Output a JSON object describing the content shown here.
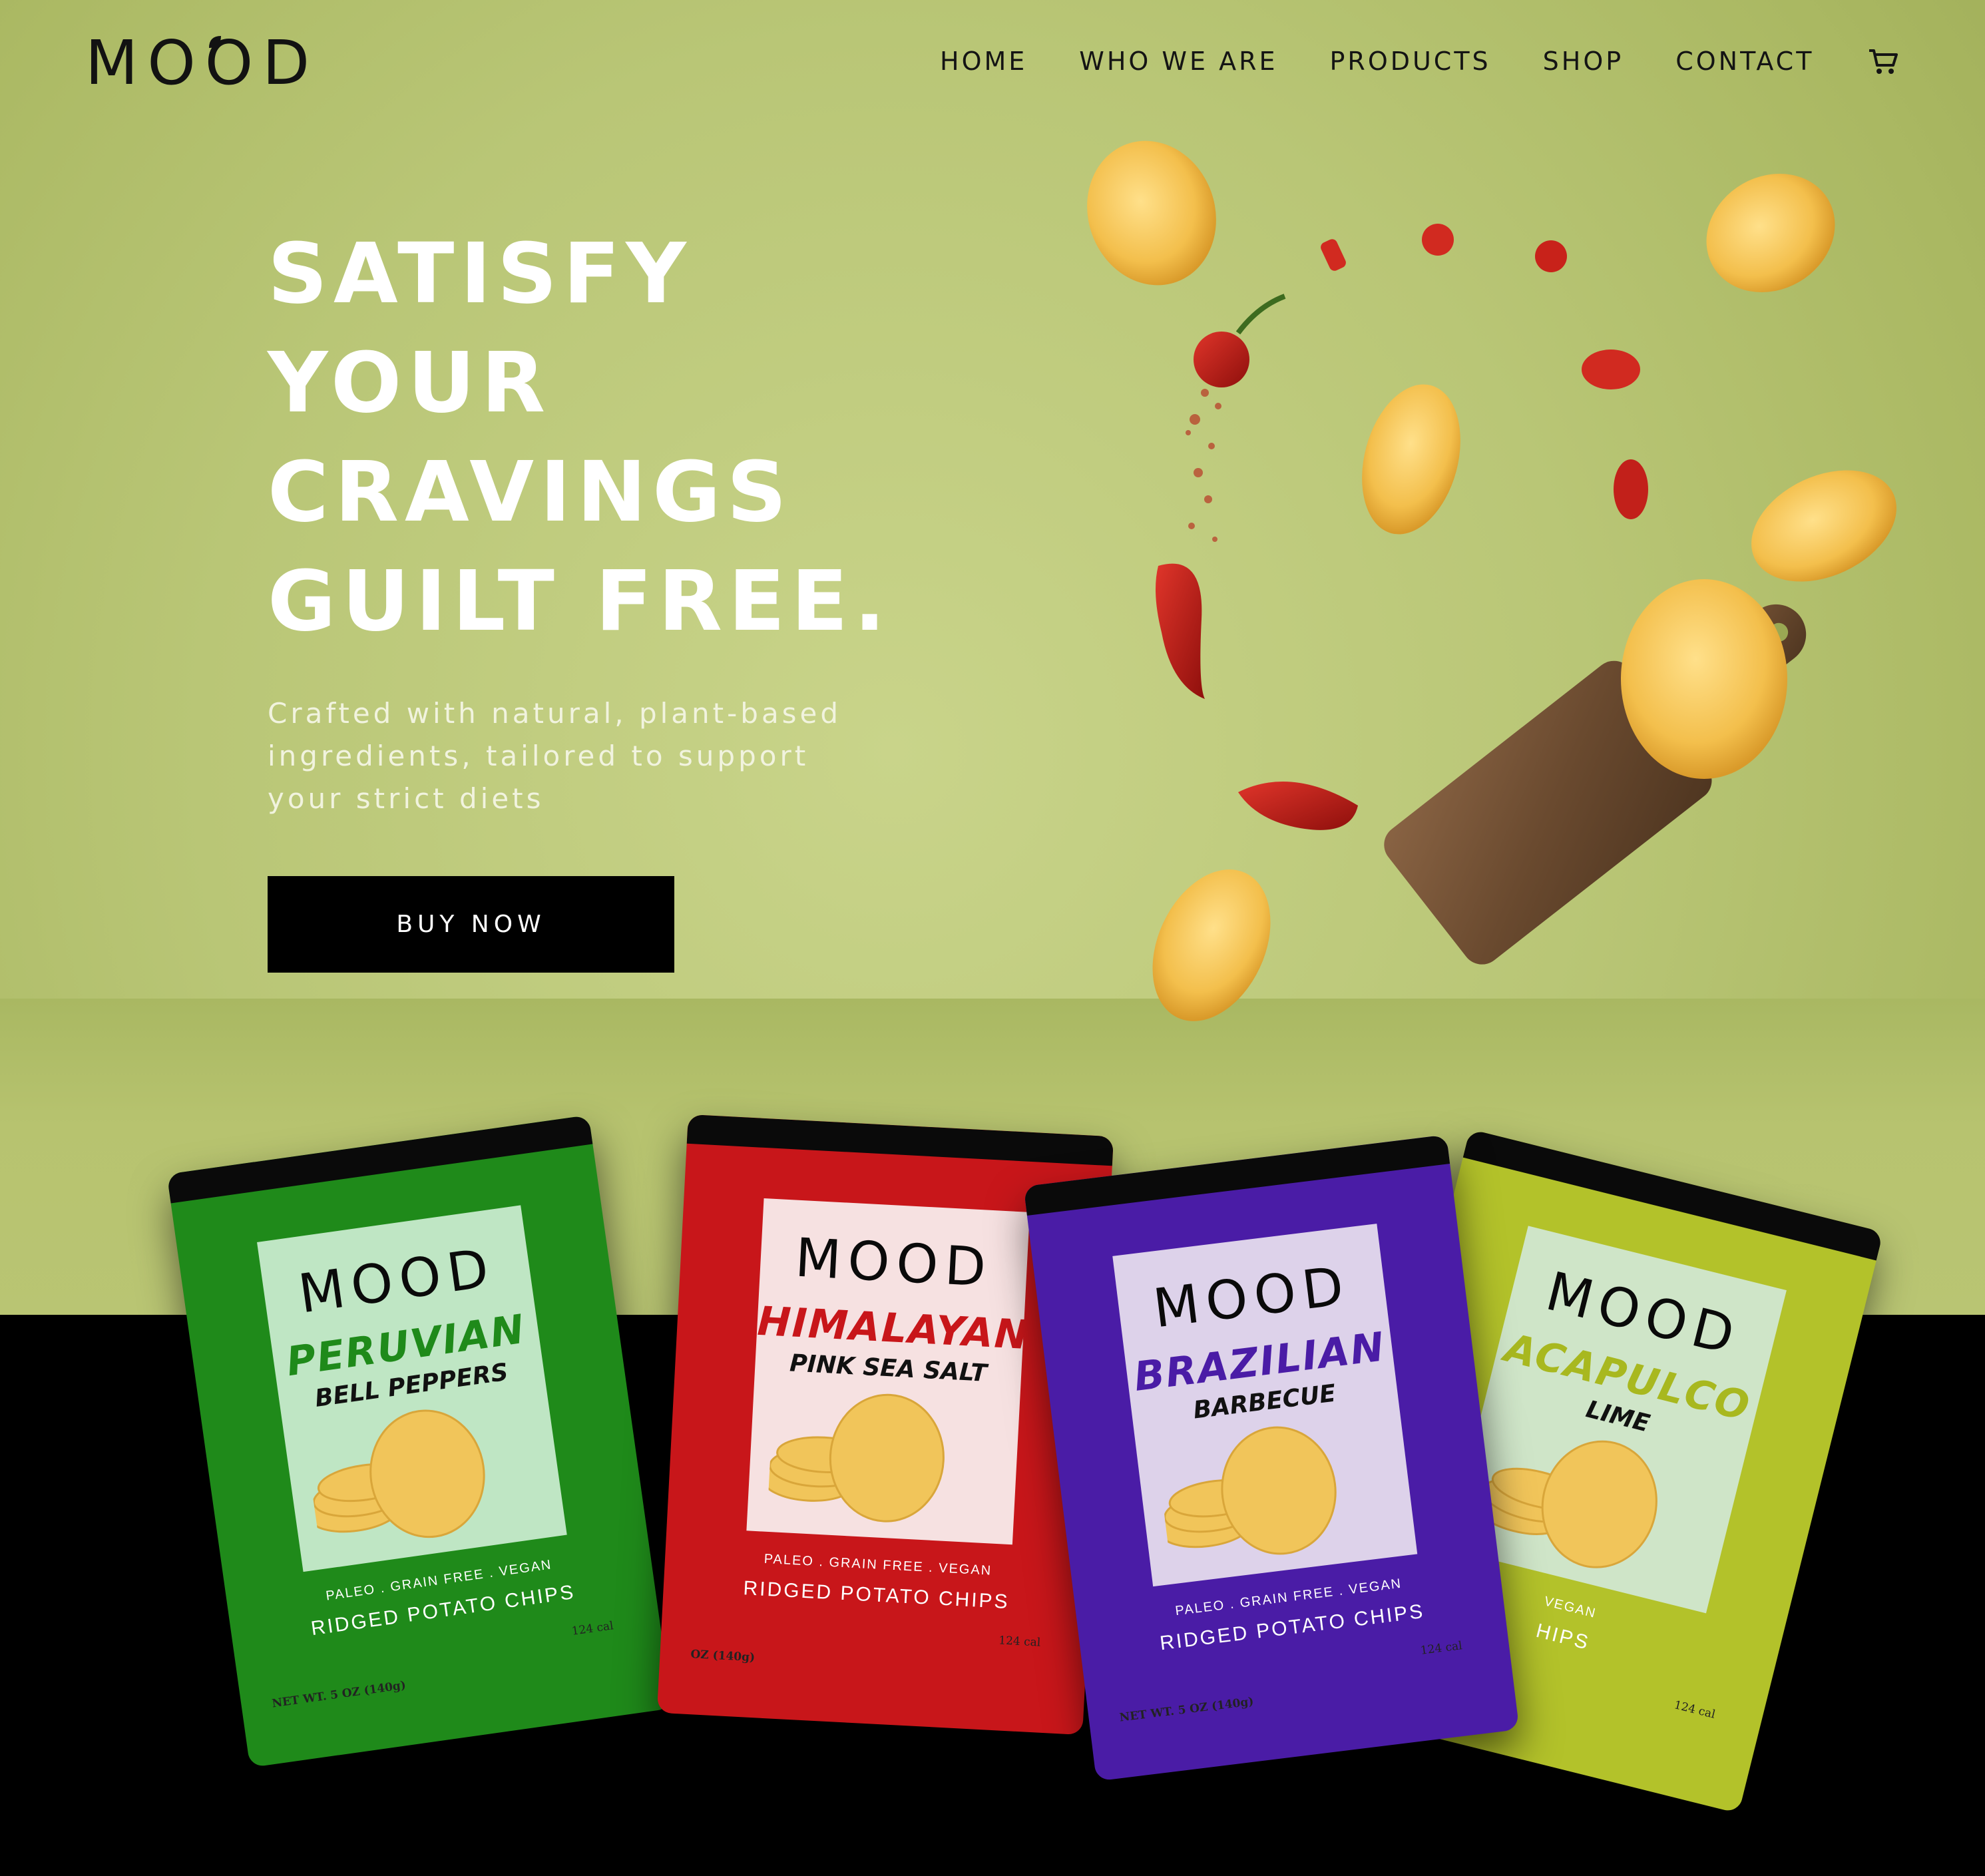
{
  "brand": {
    "name": "MOOD"
  },
  "nav": {
    "items": [
      "HOME",
      "WHO WE ARE",
      "PRODUCTS",
      "SHOP",
      "CONTACT"
    ],
    "cart_icon": "cart-icon"
  },
  "hero": {
    "headline": [
      "SATISFY",
      "YOUR",
      "CRAVINGS",
      "GUILT FREE."
    ],
    "subtitle": [
      "Crafted with natural, plant-based",
      "ingredients, tailored to support",
      "your strict diets"
    ],
    "cta_label": "BUY NOW"
  },
  "colors": {
    "background": "#b9c676",
    "floor": "#000000",
    "cta_bg": "#000000",
    "peruvian_bag": "#1f8a1a",
    "himalayan_bag": "#c8161a",
    "brazilian_bag": "#4a1ca6",
    "acapulco_bag": "#b3c22a"
  },
  "products": [
    {
      "brand": "MOOD",
      "flavor": "PERUVIAN",
      "variety": "BELL PEPPERS",
      "claims": "PALEO . GRAIN FREE . VEGAN",
      "type": "RIDGED POTATO CHIPS",
      "calories": "124 cal",
      "net_weight": "NET WT. 5 OZ (140g)"
    },
    {
      "brand": "MOOD",
      "flavor": "HIMALAYAN",
      "variety": "PINK SEA SALT",
      "claims": "PALEO . GRAIN FREE . VEGAN",
      "type": "RIDGED POTATO CHIPS",
      "calories": "124 cal",
      "net_weight": "OZ (140g)"
    },
    {
      "brand": "MOOD",
      "flavor": "BRAZILIAN",
      "variety": "BARBECUE",
      "claims": "PALEO . GRAIN FREE . VEGAN",
      "type": "RIDGED POTATO CHIPS",
      "calories": "124 cal",
      "net_weight": "NET WT. 5 OZ (140g)"
    },
    {
      "brand": "MOOD",
      "flavor": "ACAPULCO",
      "variety": "LIME",
      "claims": "VEGAN",
      "type": "HIPS",
      "calories": "124 cal",
      "net_weight": ""
    }
  ]
}
